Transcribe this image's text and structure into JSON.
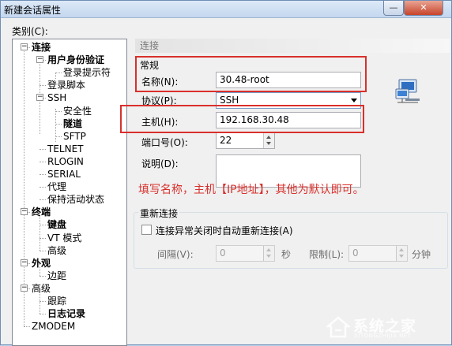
{
  "window": {
    "title": "新建会话属性",
    "close_glyph": "✕",
    "min_glyph": "—"
  },
  "category_label": "类别(C):",
  "tree": [
    {
      "label": "连接",
      "bold": true,
      "toggle": "−"
    },
    {
      "label": "用户身份验证",
      "bold": true,
      "toggle": "−"
    },
    {
      "label": "登录提示符",
      "bold": false
    },
    {
      "label": "登录脚本",
      "bold": false
    },
    {
      "label": "SSH",
      "bold": false,
      "toggle": "−"
    },
    {
      "label": "安全性",
      "bold": false
    },
    {
      "label": "隧道",
      "bold": true
    },
    {
      "label": "SFTP",
      "bold": false
    },
    {
      "label": "TELNET",
      "bold": false
    },
    {
      "label": "RLOGIN",
      "bold": false
    },
    {
      "label": "SERIAL",
      "bold": false
    },
    {
      "label": "代理",
      "bold": false
    },
    {
      "label": "保持活动状态",
      "bold": false
    },
    {
      "label": "终端",
      "bold": true,
      "toggle": "−"
    },
    {
      "label": "键盘",
      "bold": true
    },
    {
      "label": "VT 模式",
      "bold": false
    },
    {
      "label": "高级",
      "bold": false
    },
    {
      "label": "外观",
      "bold": true,
      "toggle": "−"
    },
    {
      "label": "边距",
      "bold": false
    },
    {
      "label": "高级",
      "bold": false,
      "toggle": "−"
    },
    {
      "label": "跟踪",
      "bold": false
    },
    {
      "label": "日志记录",
      "bold": true
    },
    {
      "label": "ZMODEM",
      "bold": false
    }
  ],
  "panel": {
    "section_title": "连接",
    "general_label": "常规",
    "name_label": "名称(N):",
    "name_value": "30.48-root",
    "protocol_label": "协议(P):",
    "protocol_value": "SSH",
    "host_label": "主机(H):",
    "host_value": "192.168.30.48",
    "port_label": "端口号(O):",
    "port_value": "22",
    "desc_label": "说明(D):",
    "desc_value": "",
    "annotation": "填写名称，主机【IP地址】，其他为默认即可。",
    "reconnect": {
      "title": "重新连接",
      "checkbox_label": "连接异常关闭时自动重新连接(A)",
      "checked": false,
      "interval_label": "间隔(V):",
      "interval_value": "0",
      "interval_unit": "秒",
      "limit_label": "限制(L):",
      "limit_value": "0",
      "limit_unit": "分钟"
    }
  },
  "watermark": {
    "text": "系统之家",
    "subtext": "XITONGZHIJIA.NET"
  },
  "colors": {
    "annotation_red": "#d9302c",
    "title_gradient_top": "#dce9f7",
    "section_header": "#e3e3e3"
  }
}
